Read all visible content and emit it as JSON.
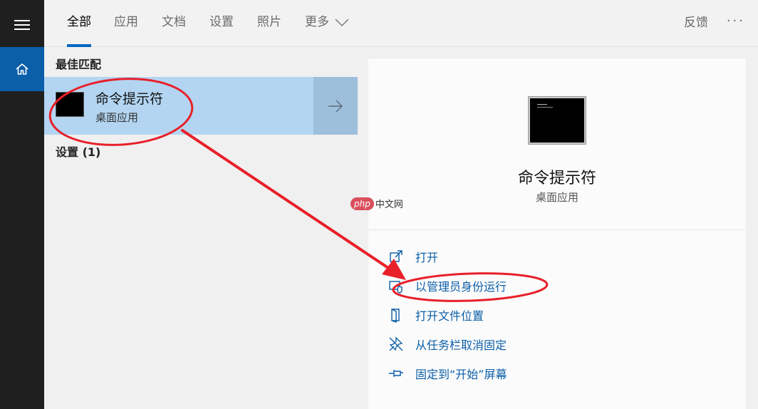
{
  "nav": {
    "menu_icon": "hamburger-menu-icon",
    "home_icon": "home-icon"
  },
  "tabs": [
    {
      "label": "全部",
      "active": true
    },
    {
      "label": "应用"
    },
    {
      "label": "文档"
    },
    {
      "label": "设置"
    },
    {
      "label": "照片"
    },
    {
      "label": "更多"
    }
  ],
  "toolbar": {
    "feedback_label": "反馈",
    "more_options_label": "···"
  },
  "results": {
    "best_match_header": "最佳匹配",
    "best_match": {
      "name": "命令提示符",
      "type": "桌面应用"
    },
    "settings_header": "设置 (1)"
  },
  "detail": {
    "name": "命令提示符",
    "type": "桌面应用",
    "actions": [
      {
        "label": "打开",
        "icon": "open-icon"
      },
      {
        "label": "以管理员身份运行",
        "icon": "run-as-admin-icon"
      },
      {
        "label": "打开文件位置",
        "icon": "file-location-icon"
      },
      {
        "label": "从任务栏取消固定",
        "icon": "unpin-taskbar-icon"
      },
      {
        "label": "固定到“开始”屏幕",
        "icon": "pin-start-icon"
      }
    ]
  },
  "watermark": {
    "badge": "php",
    "text": "中文网"
  },
  "colors": {
    "accent": "#0067c0",
    "selected_item": "#b3d5f2",
    "annotation": "#e8202a"
  }
}
